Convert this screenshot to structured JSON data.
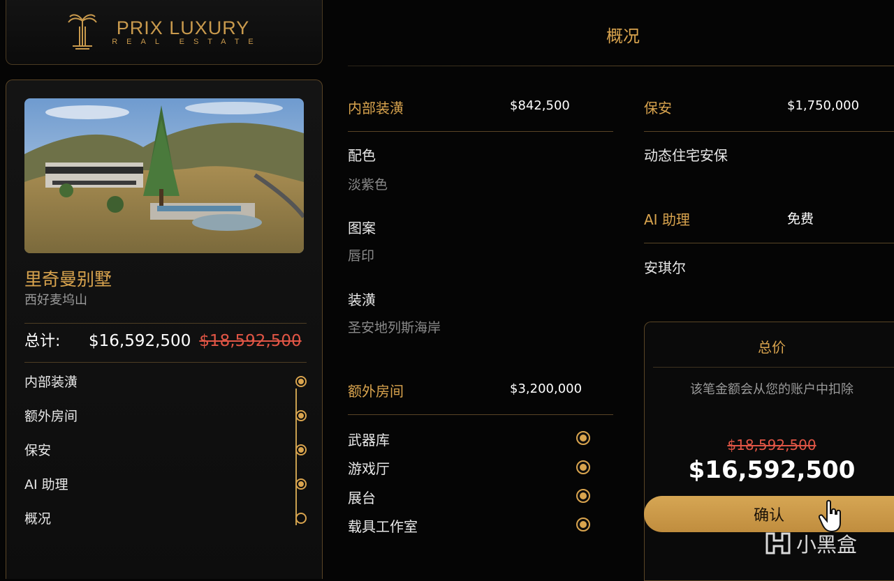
{
  "brand": {
    "name": "PRIX LUXURY",
    "sub": "REAL ESTATE"
  },
  "property": {
    "name": "里奇曼别墅",
    "location": "西好麦坞山",
    "total_label": "总计:",
    "total_price": "$16,592,500",
    "original_price": "$18,592,500"
  },
  "checklist": [
    {
      "label": "内部装潢",
      "checked": true
    },
    {
      "label": "额外房间",
      "checked": true
    },
    {
      "label": "保安",
      "checked": true
    },
    {
      "label": "AI 助理",
      "checked": true
    },
    {
      "label": "概况",
      "checked": false
    }
  ],
  "page_title": "概况",
  "interior": {
    "title": "内部装潢",
    "price": "$842,500",
    "items": [
      {
        "label": "配色",
        "value": "淡紫色"
      },
      {
        "label": "图案",
        "value": "唇印"
      },
      {
        "label": "装潢",
        "value": "圣安地列斯海岸"
      }
    ]
  },
  "extra_rooms": {
    "title": "额外房间",
    "price": "$3,200,000",
    "items": [
      "武器库",
      "游戏厅",
      "展台",
      "载具工作室"
    ]
  },
  "security": {
    "title": "保安",
    "price": "$1,750,000",
    "item": "动态住宅安保"
  },
  "ai_assistant": {
    "title": "AI 助理",
    "price": "免费",
    "item": "安琪尔"
  },
  "price_box": {
    "title": "总价",
    "note": "该笔金额会从您的账户中扣除",
    "old_price": "$18,592,500",
    "new_price": "$16,592,500",
    "confirm": "确认"
  },
  "watermark": "小黑盒",
  "colors": {
    "accent": "#d9a44e",
    "strike": "#e05545",
    "background": "#050505"
  }
}
